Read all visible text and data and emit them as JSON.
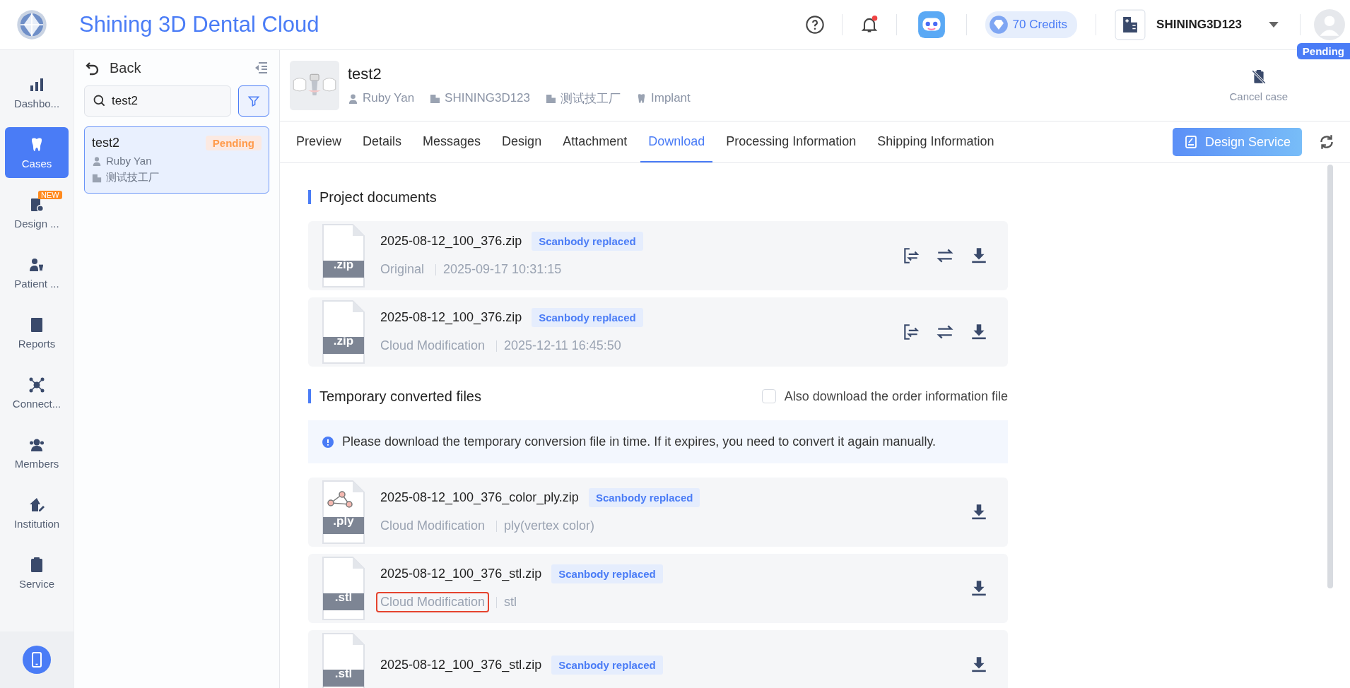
{
  "app": {
    "title": "Shining 3D Dental Cloud",
    "credits": "70 Credits",
    "organization": "SHINING3D123",
    "notification_unread": true,
    "status_badge": "Pending"
  },
  "nav": [
    {
      "kind": "dashboard",
      "label": "Dashbo...",
      "selected": false
    },
    {
      "kind": "cases",
      "label": "Cases",
      "selected": true
    },
    {
      "kind": "design",
      "label": "Design ...",
      "selected": false,
      "badge": "NEW"
    },
    {
      "kind": "patient",
      "label": "Patient ...",
      "selected": false
    },
    {
      "kind": "reports",
      "label": "Reports",
      "selected": false
    },
    {
      "kind": "connect",
      "label": "Connect...",
      "selected": false
    },
    {
      "kind": "members",
      "label": "Members",
      "selected": false
    },
    {
      "kind": "institution",
      "label": "Institution",
      "selected": false
    },
    {
      "kind": "service",
      "label": "Service",
      "selected": false
    }
  ],
  "case_list": {
    "back": "Back",
    "search": {
      "value": "test2"
    },
    "cases": [
      {
        "title": "test2",
        "status": "Pending",
        "patient": "Ruby Yan",
        "lab": "测试技工厂",
        "selected": true
      }
    ]
  },
  "case": {
    "title": "test2",
    "meta": [
      {
        "kind": "person",
        "text": "Ruby Yan"
      },
      {
        "kind": "org",
        "text": "SHINING3D123"
      },
      {
        "kind": "lab",
        "text": "测试技工厂"
      },
      {
        "kind": "category",
        "text": "Implant"
      }
    ],
    "cancel": "Cancel case"
  },
  "tabs": [
    {
      "label": "Preview",
      "selected": false
    },
    {
      "label": "Details",
      "selected": false
    },
    {
      "label": "Messages",
      "selected": false
    },
    {
      "label": "Design",
      "selected": false
    },
    {
      "label": "Attachment",
      "selected": false
    },
    {
      "label": "Download",
      "selected": true
    },
    {
      "label": "Processing Information",
      "selected": false
    },
    {
      "label": "Shipping Information",
      "selected": false
    }
  ],
  "design_service": "Design Service",
  "sections": [
    {
      "kind": "project",
      "title": "Project documents",
      "files": [
        {
          "ext": ".zip",
          "name": "2025-08-12_100_376.zip",
          "tag": "Scanbody replaced",
          "source": "Original",
          "detail": "2025-09-17 10:31:15",
          "highlighted": false
        },
        {
          "ext": ".zip",
          "name": "2025-08-12_100_376.zip",
          "tag": "Scanbody replaced",
          "source": "Cloud Modification",
          "detail": "2025-12-11 16:45:50",
          "highlighted": false
        }
      ]
    },
    {
      "kind": "temporary",
      "title": "Temporary converted files",
      "option": {
        "label": "Also download the order information file",
        "checked": false
      },
      "notice": "Please download the temporary conversion file in time. If it expires, you need to convert it again manually.",
      "files": [
        {
          "ext": ".ply",
          "name": "2025-08-12_100_376_color_ply.zip",
          "tag": "Scanbody replaced",
          "source": "Cloud Modification",
          "detail": "ply(vertex color)",
          "highlighted": false
        },
        {
          "ext": ".stl",
          "name": "2025-08-12_100_376_stl.zip",
          "tag": "Scanbody replaced",
          "source": "Cloud Modification",
          "detail": "stl",
          "highlighted": true
        },
        {
          "ext": ".stl",
          "name": "2025-08-12_100_376_stl.zip",
          "tag": "Scanbody replaced"
        }
      ]
    }
  ]
}
